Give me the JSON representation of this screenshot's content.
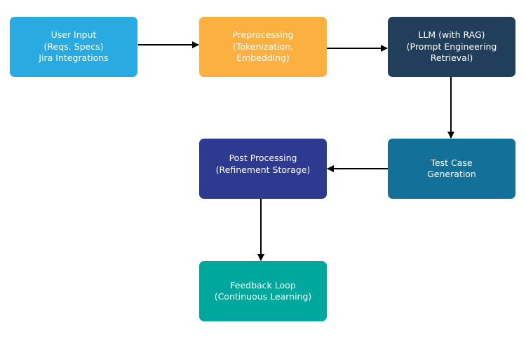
{
  "nodes": [
    {
      "id": "user-input",
      "lines": [
        "User Input",
        "(Reqs. Specs)",
        "Jira Integrations"
      ],
      "color": "#29aae1"
    },
    {
      "id": "preprocessing",
      "lines": [
        "Preprocessing",
        "(Tokenization,",
        "Embedding)"
      ],
      "color": "#fbb040"
    },
    {
      "id": "llm",
      "lines": [
        "LLM (with RAG)",
        "(Prompt Engineering",
        "Retrieval)"
      ],
      "color": "#213f5a"
    },
    {
      "id": "test-case-generation",
      "lines": [
        "Test Case",
        "Generation"
      ],
      "color": "#137098"
    },
    {
      "id": "post-processing",
      "lines": [
        "Post Processing",
        "(Refinement Storage)"
      ],
      "color": "#2e3a8f"
    },
    {
      "id": "feedback-loop",
      "lines": [
        "Feedback Loop",
        "(Continuous Learning)"
      ],
      "color": "#00a79d"
    }
  ],
  "edges": [
    [
      "user-input",
      "preprocessing"
    ],
    [
      "preprocessing",
      "llm"
    ],
    [
      "llm",
      "test-case-generation"
    ],
    [
      "test-case-generation",
      "post-processing"
    ],
    [
      "post-processing",
      "feedback-loop"
    ]
  ]
}
